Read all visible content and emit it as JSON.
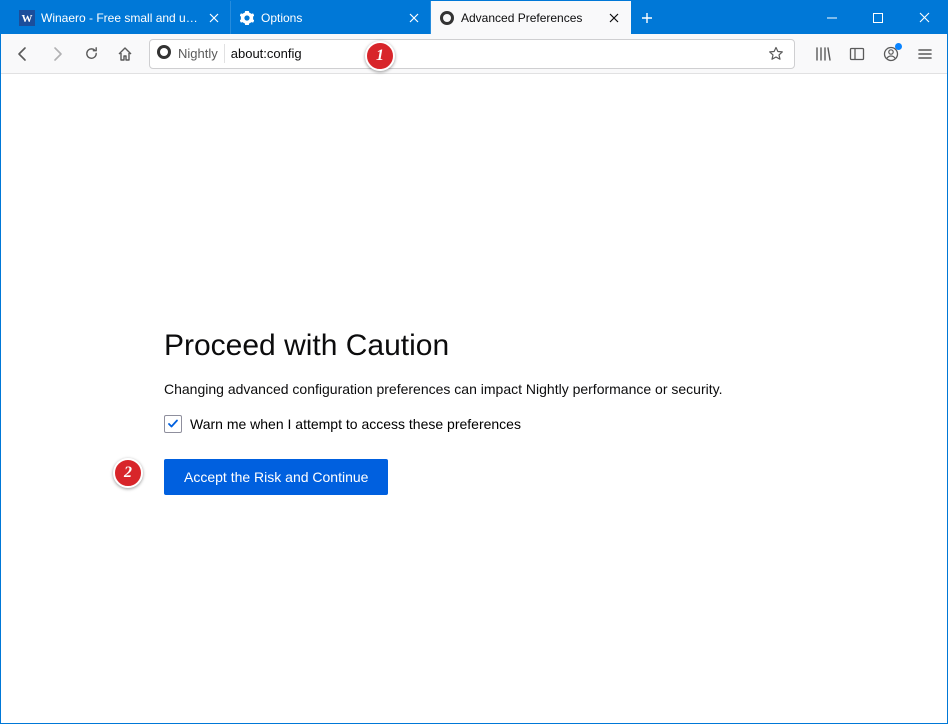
{
  "tabs": [
    {
      "label": "Winaero - Free small and usef…",
      "icon": "winaero"
    },
    {
      "label": "Options",
      "icon": "gear"
    },
    {
      "label": "Advanced Preferences",
      "icon": "firefox"
    }
  ],
  "urlbar": {
    "identity_label": "Nightly",
    "value": "about:config"
  },
  "page": {
    "title": "Proceed with Caution",
    "description": "Changing advanced configuration preferences can impact Nightly performance or security.",
    "checkbox_label": "Warn me when I attempt to access these preferences",
    "button_label": "Accept the Risk and Continue"
  },
  "annotations": {
    "badge1": "1",
    "badge2": "2"
  }
}
